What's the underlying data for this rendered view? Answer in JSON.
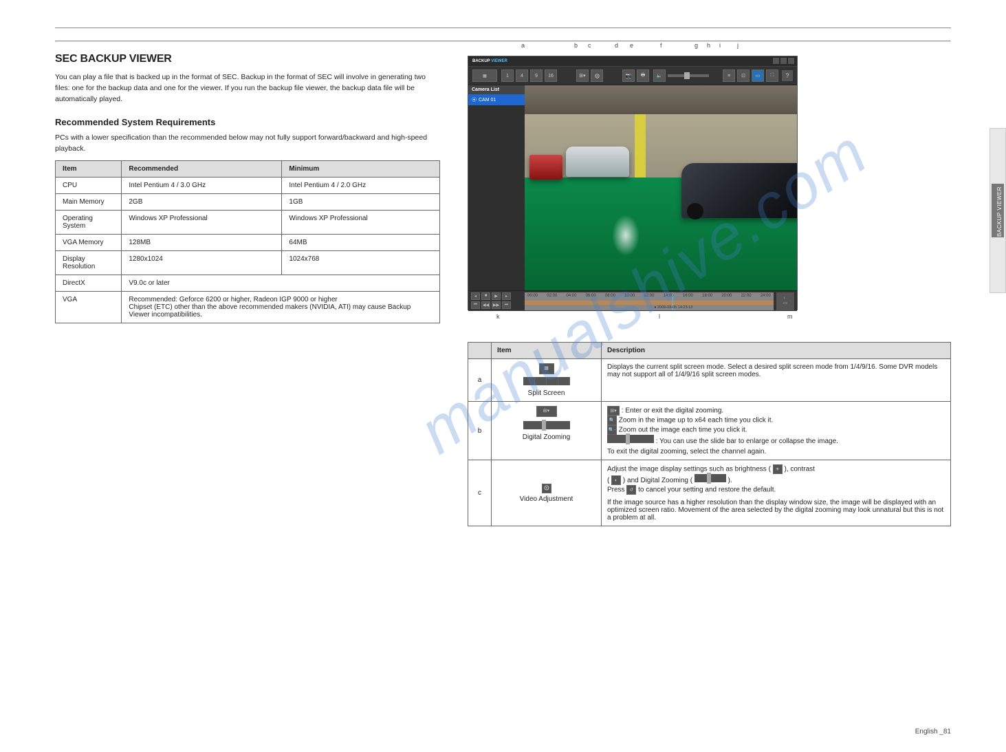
{
  "page": {
    "side_tab": "BACKUP VIEWER",
    "footer_right": "English _81",
    "watermark": "manualshive.com"
  },
  "section": {
    "title": "SEC BACKUP VIEWER",
    "intro": "You can play a file that is backed up in the format of SEC.\nBackup in the format of SEC will involve in generating two files: one for the backup data and one for the viewer.\nIf you run the backup file viewer, the backup data file will be automatically played.",
    "sysreq_title": "Recommended System Requirements",
    "sysreq_note": "PCs with a lower specification than the recommended below may not fully support forward/backward and high-speed playback."
  },
  "req_table": {
    "headers": [
      "Item",
      "Recommended",
      "Minimum"
    ],
    "rows": [
      [
        "CPU",
        "Intel Pentium 4 / 3.0 GHz",
        "Intel Pentium 4 / 2.0 GHz"
      ],
      [
        "Main Memory",
        "2GB",
        "1GB"
      ],
      [
        "Operating System",
        "Windows XP Professional",
        "Windows XP Professional"
      ],
      [
        "VGA Memory",
        "128MB",
        "64MB"
      ],
      [
        "Display Resolution",
        "1280x1024",
        "1024x768"
      ],
      [
        "DirectX",
        "V9.0c or later",
        ""
      ],
      [
        "VGA",
        "Recommended: Geforce 6200 or higher, Radeon IGP 9000 or higher\nChipset (ETC) other than the above recommended makers (NVIDIA, ATI) may cause Backup Viewer incompatibilities.",
        ""
      ]
    ]
  },
  "app": {
    "title_prefix": "BACKUP",
    "title_accent": "VIEWER",
    "camera_list_label": "Camera List",
    "camera_item": "CAM 01",
    "timeline_ticks": [
      "00:00",
      "02:00",
      "04:00",
      "06:00",
      "08:00",
      "10:00",
      "12:00",
      "14:00",
      "16:00",
      "18:00",
      "20:00",
      "22:00",
      "24:00"
    ],
    "timeline_time": "14:23",
    "timeline_date": "2009-08-05 14:23:13",
    "help": "?"
  },
  "labels": {
    "a": "a",
    "b": "b",
    "c": "c",
    "d": "d",
    "e": "e",
    "f": "f",
    "g": "g",
    "h": "h",
    "i": "i",
    "j": "j",
    "k": "k",
    "l": "l",
    "m": "m"
  },
  "feat_table": {
    "headers": [
      "",
      "Item",
      "Description"
    ],
    "rows": [
      {
        "id": "a",
        "item": "Split Screen",
        "desc": "Displays the current split screen mode.\nSelect a desired split screen mode from 1/4/9/16. Some DVR models may not support all of 1/4/9/16 split screen modes."
      },
      {
        "id": "b",
        "item": "Digital Zooming",
        "desc_lines": [
          {
            "pre_icon": "pop-small",
            "text": ": Enter or exit the digital zooming."
          },
          {
            "pre_icon": "magplus",
            "text": "Zoom in the image up to x64 each time you click it."
          },
          {
            "pre_icon": "magminus",
            "text": "Zoom out the image each time you click it."
          },
          {
            "pre_icon": "slider",
            "text": ": You can use the slide bar to enlarge or collapse the image."
          }
        ],
        "note": "To exit the digital zooming, select the channel again."
      },
      {
        "id": "c",
        "item": "Video Adjustment",
        "desc_lines": [
          {
            "text": "Adjust the image display settings such as brightness (",
            "post_icon": "brightness",
            "post_text": "), contrast"
          },
          {
            "pre_text": "(",
            "pre_icon": "contrast",
            "mid_text": ") and Digital Zooming (",
            "post_icon": "slider",
            "post_text": ")."
          },
          {
            "pre_text": "Press ",
            "pre_icon": "reset",
            "text": " to cancel your setting and restore the default."
          }
        ],
        "note": "If the image source has a higher resolution than the display window size, the image will be displayed with an optimized screen ratio. Movement of the area selected by the digital zooming may look unnatural but this is not a problem at all."
      }
    ]
  }
}
